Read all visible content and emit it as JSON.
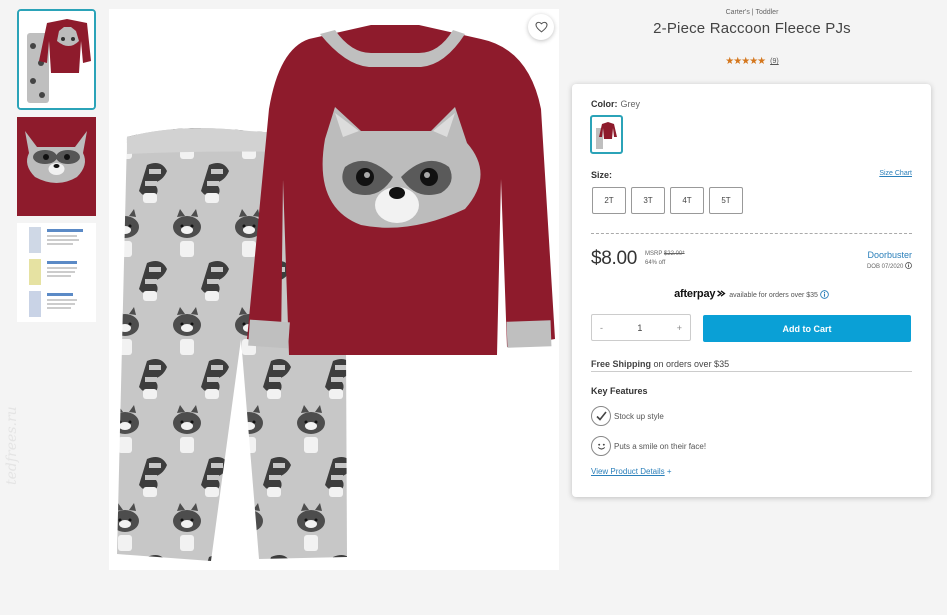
{
  "product": {
    "brand": "Carter's | Toddler",
    "title": "2-Piece Raccoon Fleece PJs",
    "stars": "★★★★★",
    "rating_value": 4.5,
    "review_count": "(9)"
  },
  "watermark": "tedfrees.ru",
  "thumbnails": [
    {
      "name": "thumb-front",
      "selected": true
    },
    {
      "name": "thumb-raccoon-detail",
      "selected": false
    },
    {
      "name": "thumb-size-chart",
      "selected": false
    }
  ],
  "options": {
    "color_label": "Color:",
    "color_value": "Grey",
    "size_label": "Size:",
    "size_chart": "Size Chart",
    "sizes": [
      "2T",
      "3T",
      "4T",
      "5T"
    ]
  },
  "pricing": {
    "price": "$8.00",
    "msrp_label": "MSRP",
    "msrp_value": "$22.00*",
    "discount": "64% off",
    "badge": "Doorbuster",
    "badge_date": "DOB 07/2020"
  },
  "afterpay": {
    "brand": "afterpay",
    "text": "available for orders over $35"
  },
  "cart": {
    "minus": "-",
    "quantity": "1",
    "plus": "+",
    "add_label": "Add to Cart"
  },
  "shipping": {
    "bold": "Free Shipping",
    "text": "on orders over $35"
  },
  "features": {
    "heading": "Key Features",
    "items": [
      "Stock up style",
      "Puts a smile on their face!"
    ],
    "view_details": "View Product Details",
    "view_plus": "+"
  },
  "colors": {
    "accent": "#2ba3b8",
    "cta": "#0aa0d6",
    "star": "#d4761c",
    "shirt": "#8e1b2c"
  },
  "icons": [
    "heart-icon",
    "info-icon",
    "check-circle-icon",
    "smile-icon"
  ]
}
